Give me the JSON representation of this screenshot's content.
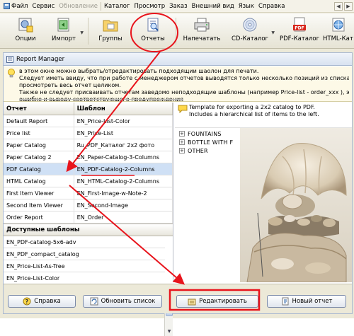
{
  "menu": [
    "Файл",
    "Сервис",
    "Обновление",
    "Каталог",
    "Просмотр",
    "Заказ",
    "Внешний вид",
    "Язык",
    "Справка"
  ],
  "toolbar": {
    "options": "Опции",
    "import": "Импорт",
    "groups": "Группы",
    "reports": "Отчеты",
    "print": "Напечатать",
    "cd_catalog": "CD-Каталог",
    "pdf_catalog": "PDF-Каталог",
    "html_catalog": "HTML-Кат"
  },
  "panel": {
    "title": "Report Manager",
    "info": [
      "в этом окне можно выбрать/отредактировать подходящии шаолон для печати.",
      "Следует иметь ввиду, что при работе с менеджером отчетов выводятся только несколько позиций из списка товар",
      "просмотреть весь отчет целиком.",
      "Также не следует присваивать отчетам заведомо неподходящие шаблоны (например Price-list - order_xxx ), это може",
      "ошибке и выводу соответствующего предупреждения"
    ]
  },
  "grid": {
    "col_report": "Отчет",
    "col_template": "Шаблон",
    "rows": [
      {
        "report": "Default Report",
        "template": "EN_Price-List-Color"
      },
      {
        "report": "Price list",
        "template": "EN_Price-List"
      },
      {
        "report": "Paper Catalog",
        "template": "Ru_PDF_Каталог 2x2 фото"
      },
      {
        "report": "Paper Catalog 2",
        "template": "EN_Paper-Catalog-3-Columns"
      },
      {
        "report": "PDF Catalog",
        "template": "EN_PDF-Catalog-2-Columns"
      },
      {
        "report": "HTML Catalog",
        "template": "EN_HTML-Catalog-2-Columns"
      },
      {
        "report": "First Item Viewer",
        "template": "EN_First-Image-w-Note-2"
      },
      {
        "report": "Second Item Viewer",
        "template": "EN_Second-Image"
      },
      {
        "report": "Order Report",
        "template": "EN_Order"
      }
    ],
    "available_header": "Доступные шаблоны",
    "available": [
      "EN_PDF-catalog-5x6-adv",
      "EN_PDF_compact_catalog",
      "EN_Price-List-As-Tree",
      "EN_Price-List-Color"
    ]
  },
  "right": {
    "desc_line1": "Template for exporting a 2x2 catalog to PDF.",
    "desc_line2": "Includes a hierarchical list of items to the left.",
    "tree": [
      "FOUNTAINS",
      "BOTTLE WITH F",
      "OTHER"
    ]
  },
  "buttons": {
    "help": "Справка",
    "refresh": "Обновить список",
    "edit": "Редактировать",
    "new_report": "Новый отчет"
  },
  "colors": {
    "annotation": "#e8141c",
    "selection": "#cfe0f5",
    "info_bg": "#fdf9e7"
  }
}
